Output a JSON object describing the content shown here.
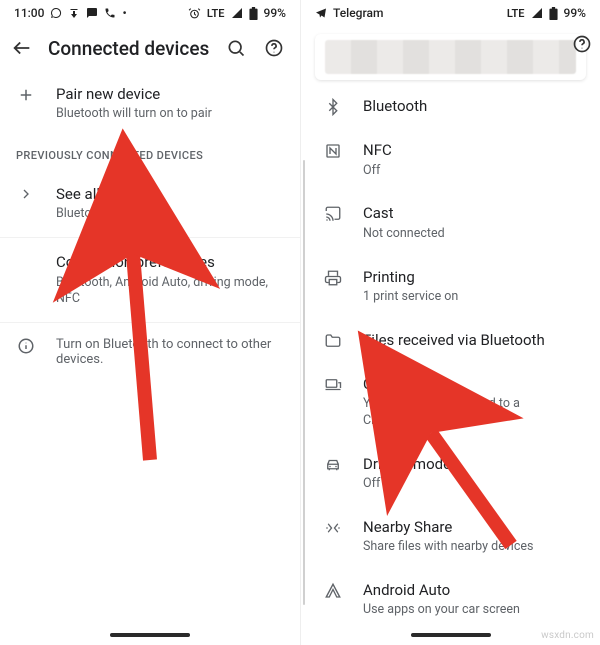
{
  "left": {
    "status": {
      "time": "11:00",
      "net": "LTE",
      "battery": "99%"
    },
    "toolbar": {
      "title": "Connected devices"
    },
    "pair": {
      "title": "Pair new device",
      "sub": "Bluetooth will turn on to pair"
    },
    "section": "PREVIOUSLY CONNECTED DEVICES",
    "seeall": {
      "title": "See all",
      "sub": "Bluetooth will turn on"
    },
    "prefs": {
      "title": "Connection preferences",
      "sub": "Bluetooth, Android Auto, driving mode, NFC"
    },
    "info": "Turn on Bluetooth to connect to other devices."
  },
  "right": {
    "status": {
      "app": "Telegram",
      "net": "LTE",
      "battery": "99%"
    },
    "items": [
      {
        "icon": "bluetooth",
        "title": "Bluetooth",
        "sub": ""
      },
      {
        "icon": "nfc",
        "title": "NFC",
        "sub": "Off"
      },
      {
        "icon": "cast",
        "title": "Cast",
        "sub": "Not connected"
      },
      {
        "icon": "print",
        "title": "Printing",
        "sub": "1 print service on"
      },
      {
        "icon": "folder",
        "title": "Files received via Bluetooth",
        "sub": ""
      },
      {
        "icon": "chromebook",
        "title": "Chromebook",
        "sub": "Your phone is not linked to a Chromebook"
      },
      {
        "icon": "car",
        "title": "Driving mode",
        "sub": "Off"
      },
      {
        "icon": "nearby",
        "title": "Nearby Share",
        "sub": "Share files with nearby devices"
      },
      {
        "icon": "auto",
        "title": "Android Auto",
        "sub": "Use apps on your car screen"
      }
    ]
  },
  "watermark": "wsxdn.com"
}
